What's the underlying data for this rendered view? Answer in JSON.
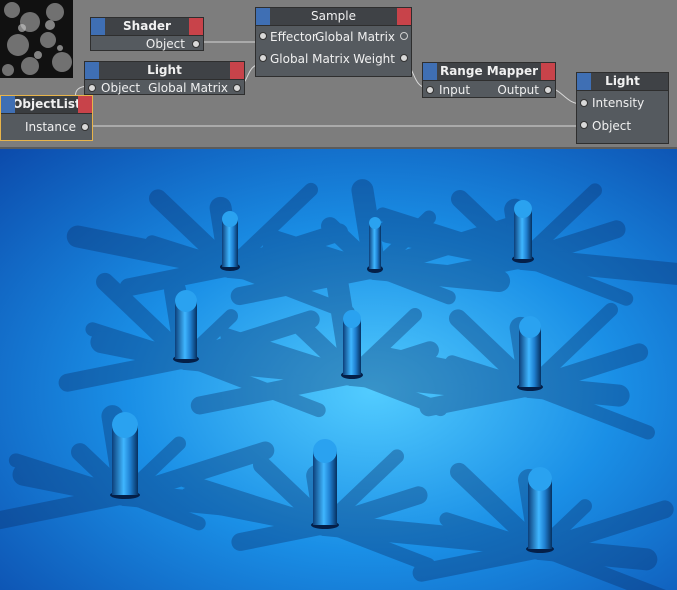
{
  "nodes": {
    "shader": {
      "title": "Shader",
      "out": "Object"
    },
    "sample": {
      "title": "Sample",
      "in1": "Effector",
      "out1": "Global Matrix",
      "in2": "Global Matrix",
      "out2": "Weight"
    },
    "light_a": {
      "title": "Light",
      "in": "Object",
      "out": "Global Matrix"
    },
    "range_mapper": {
      "title": "Range Mapper",
      "in": "Input",
      "out": "Output"
    },
    "light_b": {
      "title": "Light",
      "in1": "Intensity",
      "in2": "Object"
    },
    "object_list": {
      "title": "ObjectList",
      "out": "Instance"
    }
  },
  "colors": {
    "editor_bg": "#7d7d7d",
    "node_body": "#555a5f",
    "node_title": "#3f4246",
    "cap_blue": "#3f6fb4",
    "cap_red": "#c8434a",
    "selected_border": "#e8b44a",
    "scene_blue_dark": "#0b47a8",
    "scene_blue_light": "#52ccff"
  }
}
